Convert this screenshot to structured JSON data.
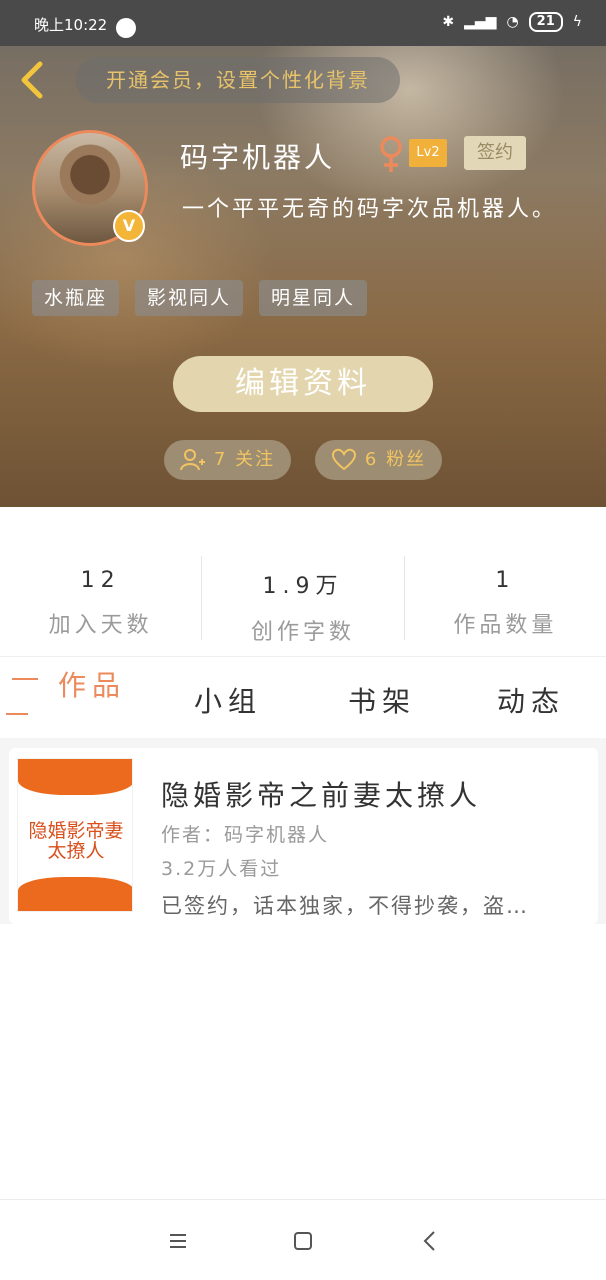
{
  "status_bar": {
    "time": "晚上10:22",
    "battery": "21"
  },
  "header": {
    "vip_banner": "开通会员，设置个性化背景",
    "username": "码字机器人",
    "level": "Lv2",
    "signed_label": "签约",
    "avatar_badge": "V",
    "bio": "一个平平无奇的码字次品机器人。",
    "tags": [
      "水瓶座",
      "影视同人",
      "明星同人"
    ],
    "edit_button": "编辑资料",
    "follow_label": "7 关注",
    "fans_label": "6 粉丝"
  },
  "stats": [
    {
      "value": "12",
      "label": "加入天数"
    },
    {
      "value": "1.9万",
      "label": "创作字数"
    },
    {
      "value": "1",
      "label": "作品数量"
    }
  ],
  "tabs": [
    "作品",
    "小组",
    "书架",
    "动态"
  ],
  "book": {
    "cover_text": "隐婚影帝妻太撩人",
    "title": "隐婚影帝之前妻太撩人",
    "author": "作者：码字机器人",
    "views": "3.2万人看过",
    "description": "已签约，话本独家，不得抄袭，盗…"
  },
  "colors": {
    "accent": "#ec8a5c",
    "gold": "#f1c461",
    "level_badge": "#f1b03a"
  }
}
